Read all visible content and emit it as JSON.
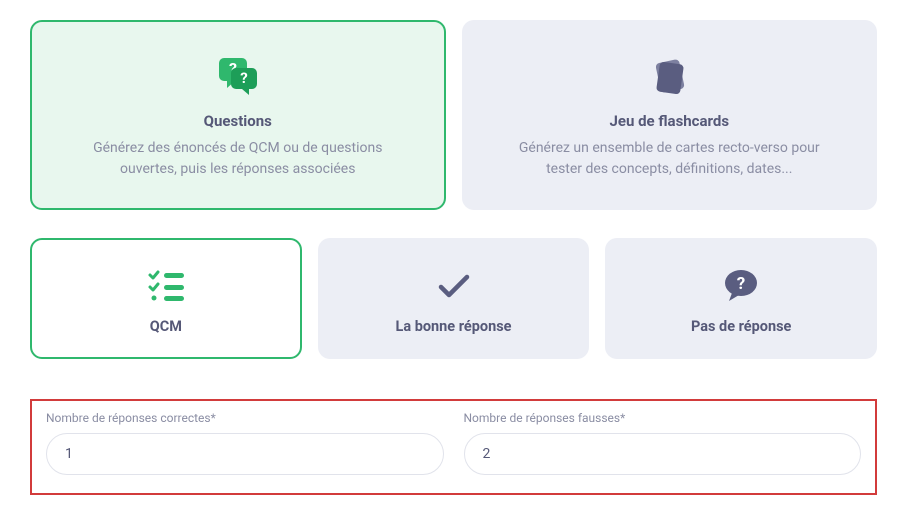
{
  "top_cards": {
    "questions": {
      "title": "Questions",
      "desc": "Générez des énoncés de QCM ou de questions ouvertes, puis les réponses associées"
    },
    "flashcards": {
      "title": "Jeu de flashcards",
      "desc": "Générez un ensemble de cartes recto-verso pour tester des concepts, définitions, dates..."
    }
  },
  "tiles": {
    "qcm": {
      "title": "QCM"
    },
    "bonne_reponse": {
      "title": "La bonne réponse"
    },
    "pas_de_reponse": {
      "title": "Pas de réponse"
    }
  },
  "fields": {
    "correct": {
      "label": "Nombre de réponses correctes*",
      "value": "1"
    },
    "wrong": {
      "label": "Nombre de réponses fausses*",
      "value": "2"
    }
  },
  "colors": {
    "green": "#2fb86d",
    "greenLight": "#e8f7ee",
    "grayBg": "#eceef5",
    "textDark": "#555877",
    "textMuted": "#8a8da3",
    "red": "#d23b3b"
  }
}
